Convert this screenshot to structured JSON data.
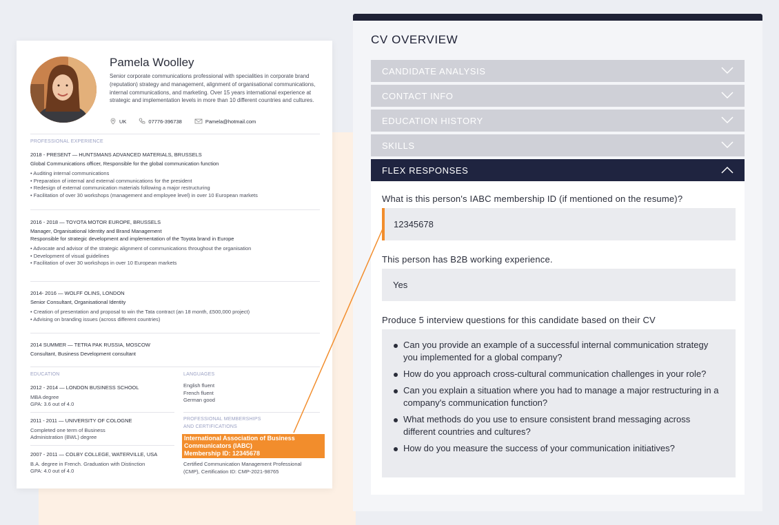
{
  "resume": {
    "name": "Pamela Woolley",
    "summary": "Senior corporate communications professional with specialities in corporate brand (reputation) strategy and management, alignment of organisational communications, internal communications, and marketing. Over 15 years international experience at strategic and implementation levels in more than 10 different countries and cultures.",
    "contacts": {
      "location": "UK",
      "phone": "07776-396738",
      "email": "Pamela@hotmail.com"
    },
    "experience_label": "PROFESSIONAL EXPERIENCE",
    "jobs": [
      {
        "heading": "2018 - PRESENT — HUNTSMANS ADVANCED MATERIALS, BRUSSELS",
        "role": "Global Communications officer",
        "role_desc": ", Responsible for the global communication function",
        "extra": "",
        "bullets": [
          "Auditing internal communications",
          "Preparation of internal and external communications for the president",
          "Redesign of external communication materials following a major restructuring",
          "Facilitation of over 30 workshops (management and employee level) in over 10 European markets"
        ]
      },
      {
        "heading": "2016 - 2018 — TOYOTA MOTOR EUROPE, BRUSSELS",
        "role": "Manager",
        "role_desc": ", Organisational Identity and Brand Management",
        "extra": "Responsible for strategic development and implementation of the Toyota brand in Europe",
        "bullets": [
          "Advocate and advisor of the strategic alignment of communications throughout the organisation",
          "Development of visual guidelines",
          "Facilitation of over 30 workshops in over 10 European markets"
        ]
      },
      {
        "heading": "2014- 2016 — WOLFF OLINS, LONDON",
        "role": "Senior Consultant",
        "role_desc": ", Organisational Identity",
        "extra": "",
        "bullets": [
          "Creation of presentation and proposal to win the Tata contract (an 18 month, £500,000 project)",
          "Advising on branding issues (across different countries)"
        ]
      },
      {
        "heading": "2014 SUMMER — TETRA PAK RUSSIA, MOSCOW",
        "role": "Consultant",
        "role_desc": ", Business Development consultant",
        "extra": "",
        "bullets": []
      }
    ],
    "education_label": "EDUCATION",
    "education": [
      {
        "heading": "2012 - 2014 — LONDON BUSINESS SCHOOL",
        "lines": [
          "MBA degree",
          "GPA: 3.6 out of 4.0"
        ]
      },
      {
        "heading": "2011 - 2011 — UNIVERSITY OF COLOGNE",
        "lines": [
          "Completed one term of Business",
          "Administration (BWL) degree"
        ]
      },
      {
        "heading": "2007 - 2011 — COLBY COLLEGE, WATERVILLE, USA",
        "lines": [
          "B.A. degree in French. Graduation with Distinction",
          "GPA: 4.0 out of 4.0"
        ]
      }
    ],
    "languages_label": "LANGUAGES",
    "languages": [
      "English fluent",
      "French fluent",
      "German good"
    ],
    "memberships_label_1": "PROFESSIONAL MEMBERSHIPS",
    "memberships_label_2": "AND CERTIFICATIONS",
    "highlight_lines": [
      "International Association of Business",
      "Communicators (IABC)",
      "Membership ID: 12345678"
    ],
    "cert_lines": [
      "Certified Communication Management Professional",
      "(CMP), Certification ID: CMP-2021-98765"
    ]
  },
  "panel": {
    "title": "CV OVERVIEW",
    "sections": [
      {
        "label": "CANDIDATE ANALYSIS",
        "expanded": false
      },
      {
        "label": "CONTACT INFO",
        "expanded": false
      },
      {
        "label": "EDUCATION HISTORY",
        "expanded": false
      },
      {
        "label": "SKILLS",
        "expanded": false
      },
      {
        "label": "FLEX RESPONSES",
        "expanded": true
      }
    ],
    "questions": [
      {
        "question": "What is this person's IABC membership ID (if mentioned on the resume)?",
        "answer": "12345678"
      },
      {
        "question": "This person has B2B working experience.",
        "answer": "Yes"
      },
      {
        "question": "Produce 5 interview questions for this candidate based on their CV",
        "answers": [
          "Can you provide an example of a successful internal communication strategy you implemented for a global company?",
          "How do you approach cross-cultural communication challenges in your role?",
          "Can you explain a situation where you had to manage a major restructuring in a company's communication function?",
          "What methods do you use to ensure consistent brand messaging across different countries and cultures?",
          "How do you measure the success of your communication initiatives?"
        ]
      }
    ]
  },
  "colors": {
    "accent": "#f28d2c",
    "navy": "#1f2440",
    "collapsed": "#cfd0d7"
  }
}
